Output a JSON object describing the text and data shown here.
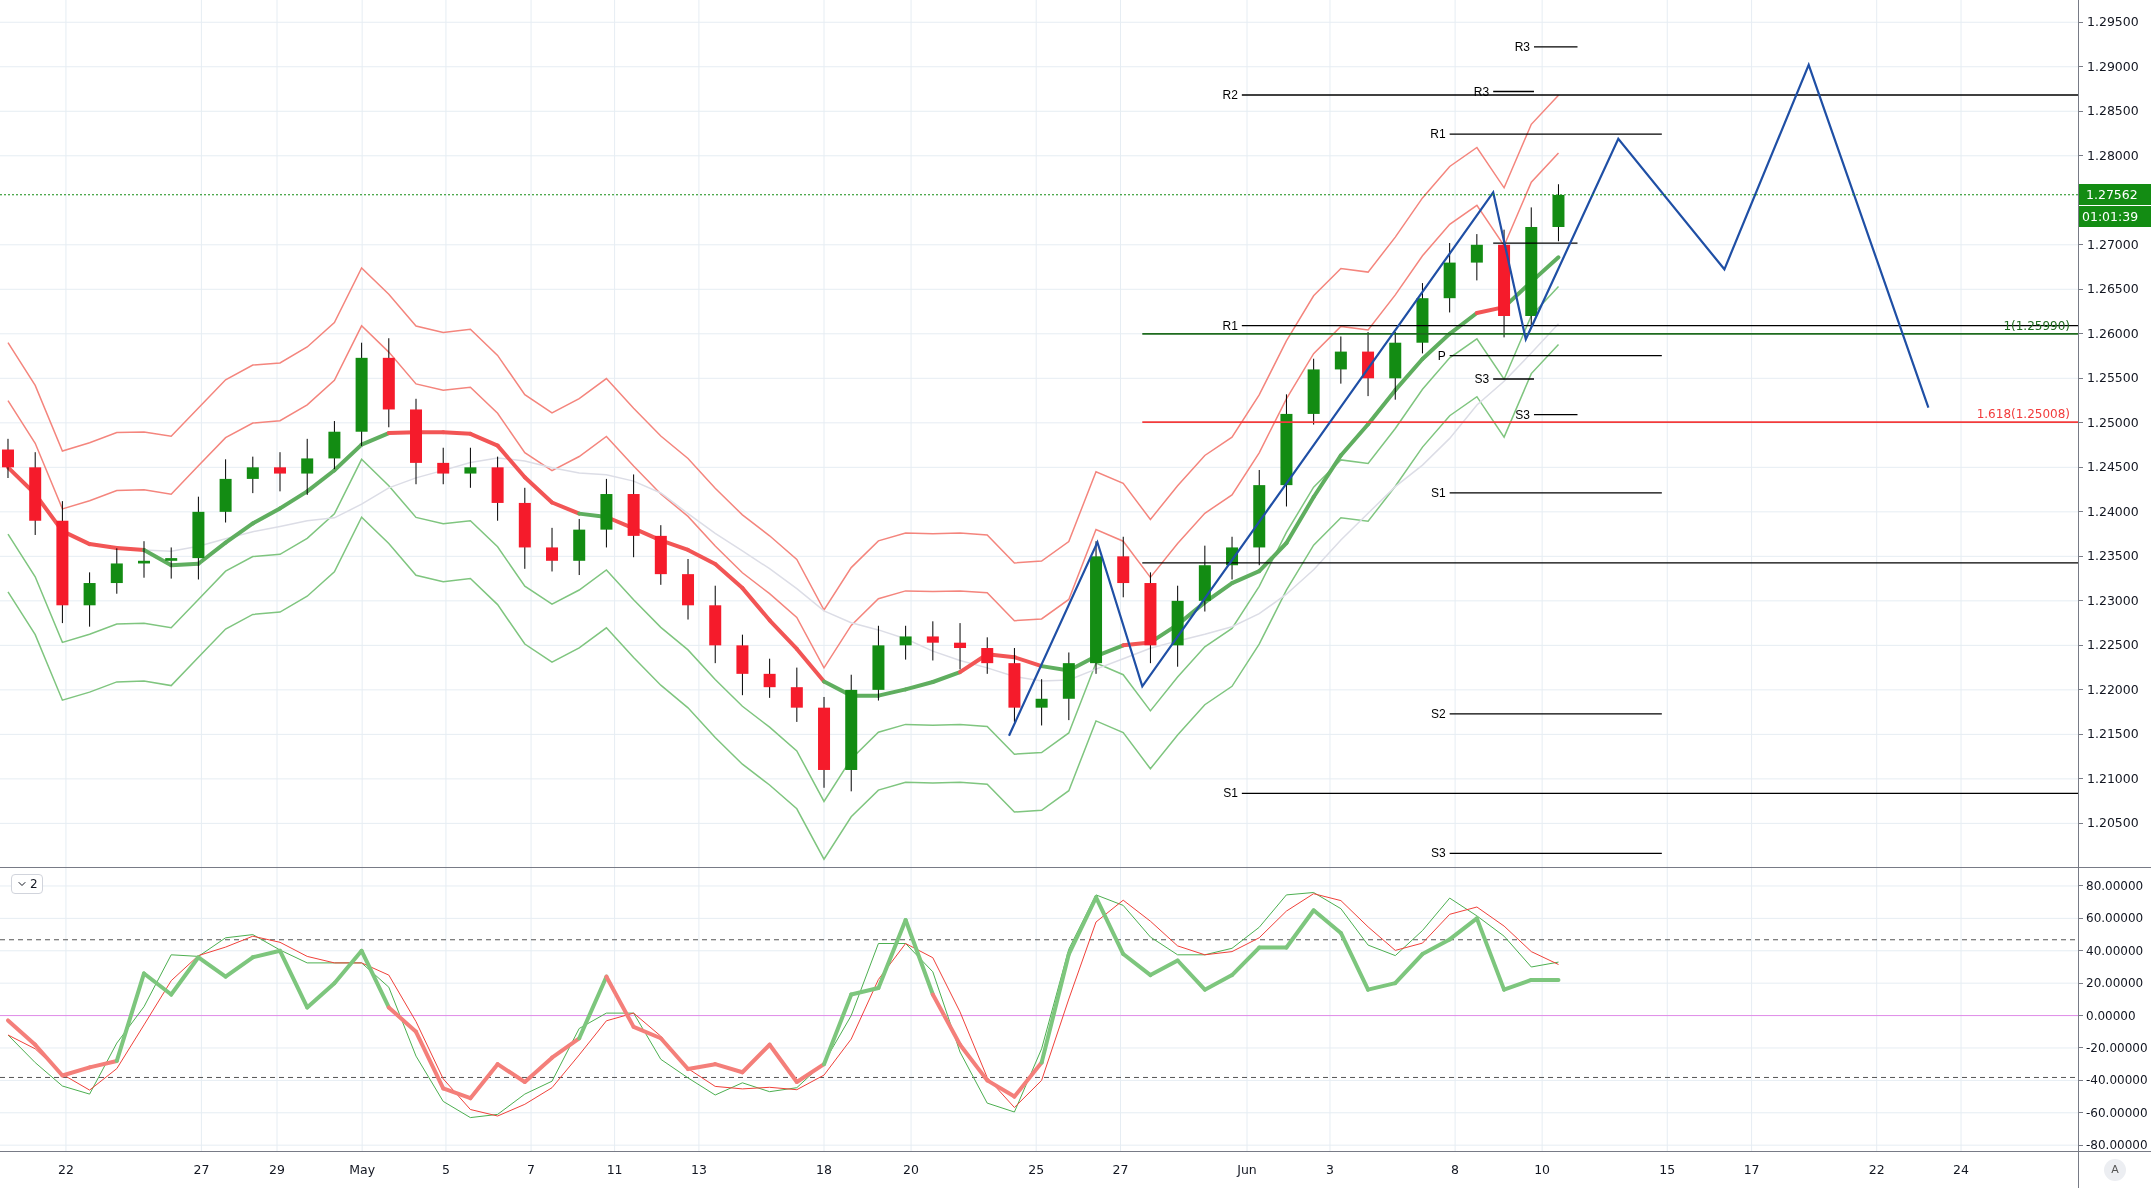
{
  "price_chart": {
    "axis_labels": [
      "1.29500",
      "1.29000",
      "1.28500",
      "1.28000",
      "1.27000",
      "1.26500",
      "1.26000",
      "1.25500",
      "1.25000",
      "1.24500",
      "1.24000",
      "1.23500",
      "1.23000",
      "1.22500",
      "1.22000",
      "1.21500",
      "1.21000",
      "1.20500"
    ],
    "pivot_levels": [
      {
        "label": "R3"
      },
      {
        "label": "R2"
      },
      {
        "label": "R3"
      },
      {
        "label": "R1"
      },
      {
        "label": "R1"
      },
      {
        "label": "P"
      },
      {
        "label": "S3"
      },
      {
        "label": "S3"
      },
      {
        "label": "S1"
      },
      {
        "label": "S2"
      },
      {
        "label": "S1"
      },
      {
        "label": "S3"
      }
    ],
    "fib_levels": [
      {
        "text": "1(1.25990)",
        "color": "#1e6b1e"
      },
      {
        "text": "1.618(1.25008)",
        "color": "#f23b3b"
      }
    ],
    "last_price": {
      "value": "1.27562",
      "countdown": "01:01:39"
    }
  },
  "oscillator": {
    "legend": "2",
    "axis_labels": [
      "80.00000",
      "60.00000",
      "40.00000",
      "20.00000",
      "0.00000",
      "-20.00000",
      "-40.00000",
      "-60.00000",
      "-80.00000"
    ]
  },
  "time_axis": {
    "labels": [
      "22",
      "27",
      "29",
      "May",
      "5",
      "7",
      "11",
      "13",
      "18",
      "20",
      "25",
      "27",
      "Jun",
      "3",
      "8",
      "10",
      "15",
      "17",
      "22",
      "24"
    ]
  },
  "auto_scale_button": "A"
}
